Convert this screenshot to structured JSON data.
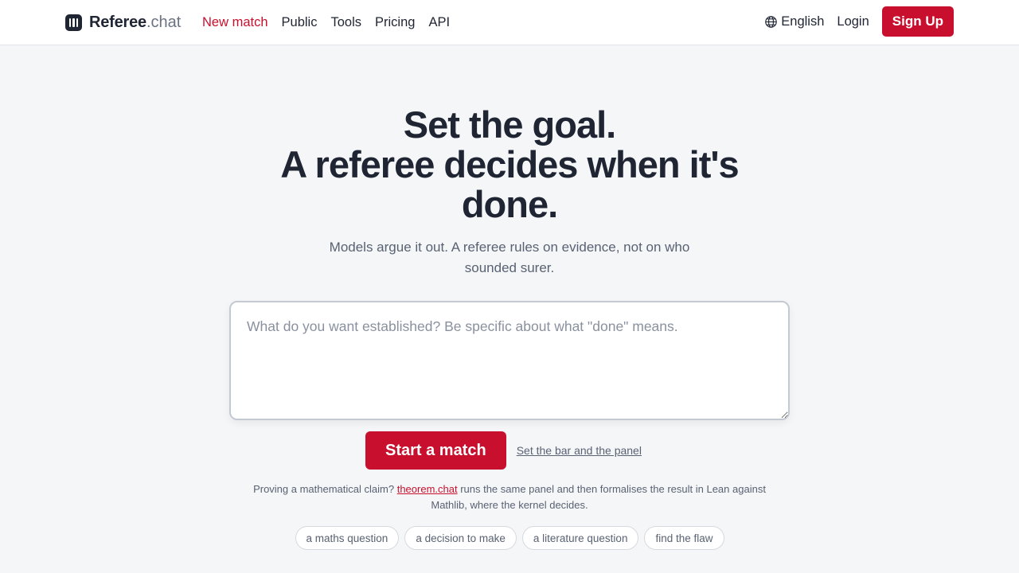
{
  "brand": {
    "name": "Referee",
    "tld": ".chat",
    "icon": "brand-logo-icon"
  },
  "nav": [
    {
      "label": "New match",
      "active": true
    },
    {
      "label": "Public",
      "active": false
    },
    {
      "label": "Tools",
      "active": false
    },
    {
      "label": "Pricing",
      "active": false
    },
    {
      "label": "API",
      "active": false
    }
  ],
  "header_right": {
    "language": "English",
    "language_icon": "globe-icon",
    "login": "Login",
    "signup": "Sign Up"
  },
  "hero": {
    "title_lines": [
      "Set the goal.",
      "A referee decides when it's",
      "done."
    ],
    "subtitle": "Models argue it out. A referee rules on evidence, not on who sounded surer."
  },
  "composer": {
    "placeholder": "What do you want established? Be specific about what \"done\" means.",
    "value": ""
  },
  "actions": {
    "start": "Start a match",
    "settings_link": "Set the bar and the panel"
  },
  "note": {
    "before": "Proving a mathematical claim? ",
    "link": "theorem.chat",
    "after": " runs the same panel and then formalises the result in Lean against Mathlib, where the kernel decides."
  },
  "chips": [
    "a maths question",
    "a decision to make",
    "a literature question",
    "find the flaw"
  ],
  "colors": {
    "accent": "#c8102e",
    "text": "#1f2533",
    "muted": "#596273",
    "background": "#f5f6f8"
  }
}
